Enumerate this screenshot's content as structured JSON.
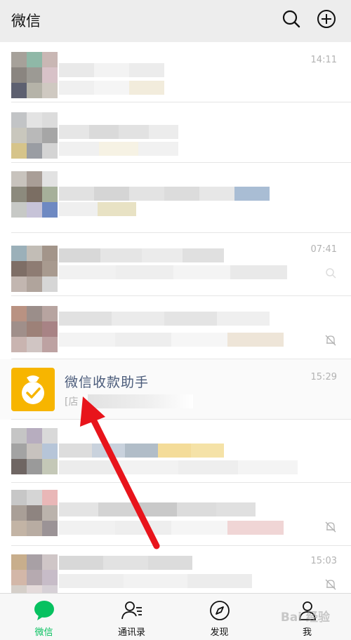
{
  "header": {
    "title": "微信",
    "search_icon": "search-icon",
    "add_icon": "plus-circle-icon"
  },
  "chats": [
    {
      "time": "14:11",
      "muted": false
    },
    {
      "time": "",
      "muted": false
    },
    {
      "time": "",
      "muted": false
    },
    {
      "time": "07:41",
      "muted": false
    },
    {
      "time": "",
      "muted": true
    },
    {
      "name": "微信收款助手",
      "preview": "[店",
      "time": "15:29",
      "muted": false,
      "icon": "money-bag-icon"
    },
    {
      "time": "",
      "muted": false
    },
    {
      "time": "",
      "muted": true
    },
    {
      "time": "15:03",
      "muted": true
    }
  ],
  "tabs": [
    {
      "label": "微信",
      "icon": "chat-bubble-icon",
      "active": true
    },
    {
      "label": "通讯录",
      "icon": "contacts-icon",
      "active": false
    },
    {
      "label": "发现",
      "icon": "compass-icon",
      "active": false
    },
    {
      "label": "我",
      "icon": "person-icon",
      "active": false
    }
  ],
  "watermark": "Bai 经验",
  "colors": {
    "accent": "#07c160",
    "highlight_avatar": "#f7b500",
    "arrow": "#e8141b"
  }
}
